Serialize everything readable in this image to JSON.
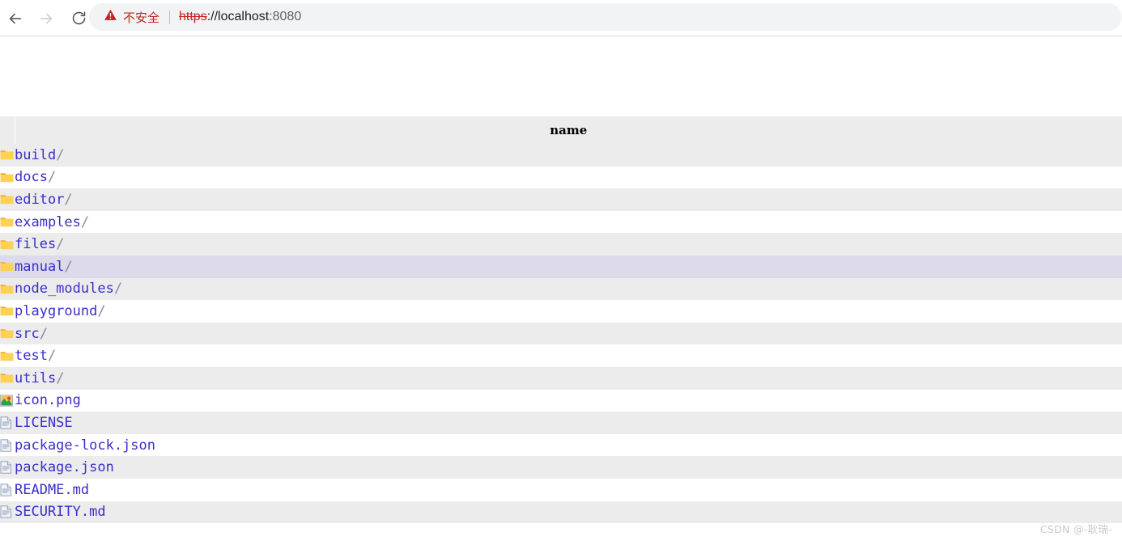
{
  "browser": {
    "back_icon": "arrow-left-icon",
    "forward_icon": "arrow-right-icon",
    "reload_icon": "reload-icon",
    "security": {
      "icon": "warning-triangle-icon",
      "label": "不安全",
      "color": "#c5221f"
    },
    "url": {
      "scheme": "https",
      "separator": "://",
      "host": "localhost",
      "port": ":8080",
      "full": "https://localhost:8080"
    }
  },
  "page": {
    "breadcrumb": {
      "leading_link": "",
      "separator": "/"
    },
    "table": {
      "columns": [
        "",
        "name"
      ],
      "header_name": "name",
      "rows": [
        {
          "icon": "folder-icon",
          "name": "build",
          "suffix": "/",
          "type": "dir",
          "highlight": false
        },
        {
          "icon": "folder-icon",
          "name": "docs",
          "suffix": "/",
          "type": "dir",
          "highlight": false
        },
        {
          "icon": "folder-icon",
          "name": "editor",
          "suffix": "/",
          "type": "dir",
          "highlight": false
        },
        {
          "icon": "folder-icon",
          "name": "examples",
          "suffix": "/",
          "type": "dir",
          "highlight": false
        },
        {
          "icon": "folder-icon",
          "name": "files",
          "suffix": "/",
          "type": "dir",
          "highlight": false
        },
        {
          "icon": "folder-icon",
          "name": "manual",
          "suffix": "/",
          "type": "dir",
          "highlight": true
        },
        {
          "icon": "folder-icon",
          "name": "node_modules",
          "suffix": "/",
          "type": "dir",
          "highlight": false
        },
        {
          "icon": "folder-icon",
          "name": "playground",
          "suffix": "/",
          "type": "dir",
          "highlight": false
        },
        {
          "icon": "folder-icon",
          "name": "src",
          "suffix": "/",
          "type": "dir",
          "highlight": false
        },
        {
          "icon": "folder-icon",
          "name": "test",
          "suffix": "/",
          "type": "dir",
          "highlight": false
        },
        {
          "icon": "folder-icon",
          "name": "utils",
          "suffix": "/",
          "type": "dir",
          "highlight": false
        },
        {
          "icon": "image-file-icon",
          "name": "icon.png",
          "suffix": "",
          "type": "image",
          "highlight": false
        },
        {
          "icon": "document-file-icon",
          "name": "LICENSE",
          "suffix": "",
          "type": "file",
          "highlight": false
        },
        {
          "icon": "document-file-icon",
          "name": "package-lock.json",
          "suffix": "",
          "type": "file",
          "highlight": false
        },
        {
          "icon": "document-file-icon",
          "name": "package.json",
          "suffix": "",
          "type": "file",
          "highlight": false
        },
        {
          "icon": "document-file-icon",
          "name": "README.md",
          "suffix": "",
          "type": "file",
          "highlight": false
        },
        {
          "icon": "document-file-icon",
          "name": "SECURITY.md",
          "suffix": "",
          "type": "file",
          "highlight": false
        }
      ]
    },
    "watermark": "CSDN @-耿瑞-"
  },
  "colors": {
    "link": "#3b2fc9",
    "row_alt": "#ececec",
    "row_highlight": "#dcdaeb",
    "folder": "#fdd663",
    "warning": "#c5221f",
    "omnibox": "#f1f3f4"
  }
}
